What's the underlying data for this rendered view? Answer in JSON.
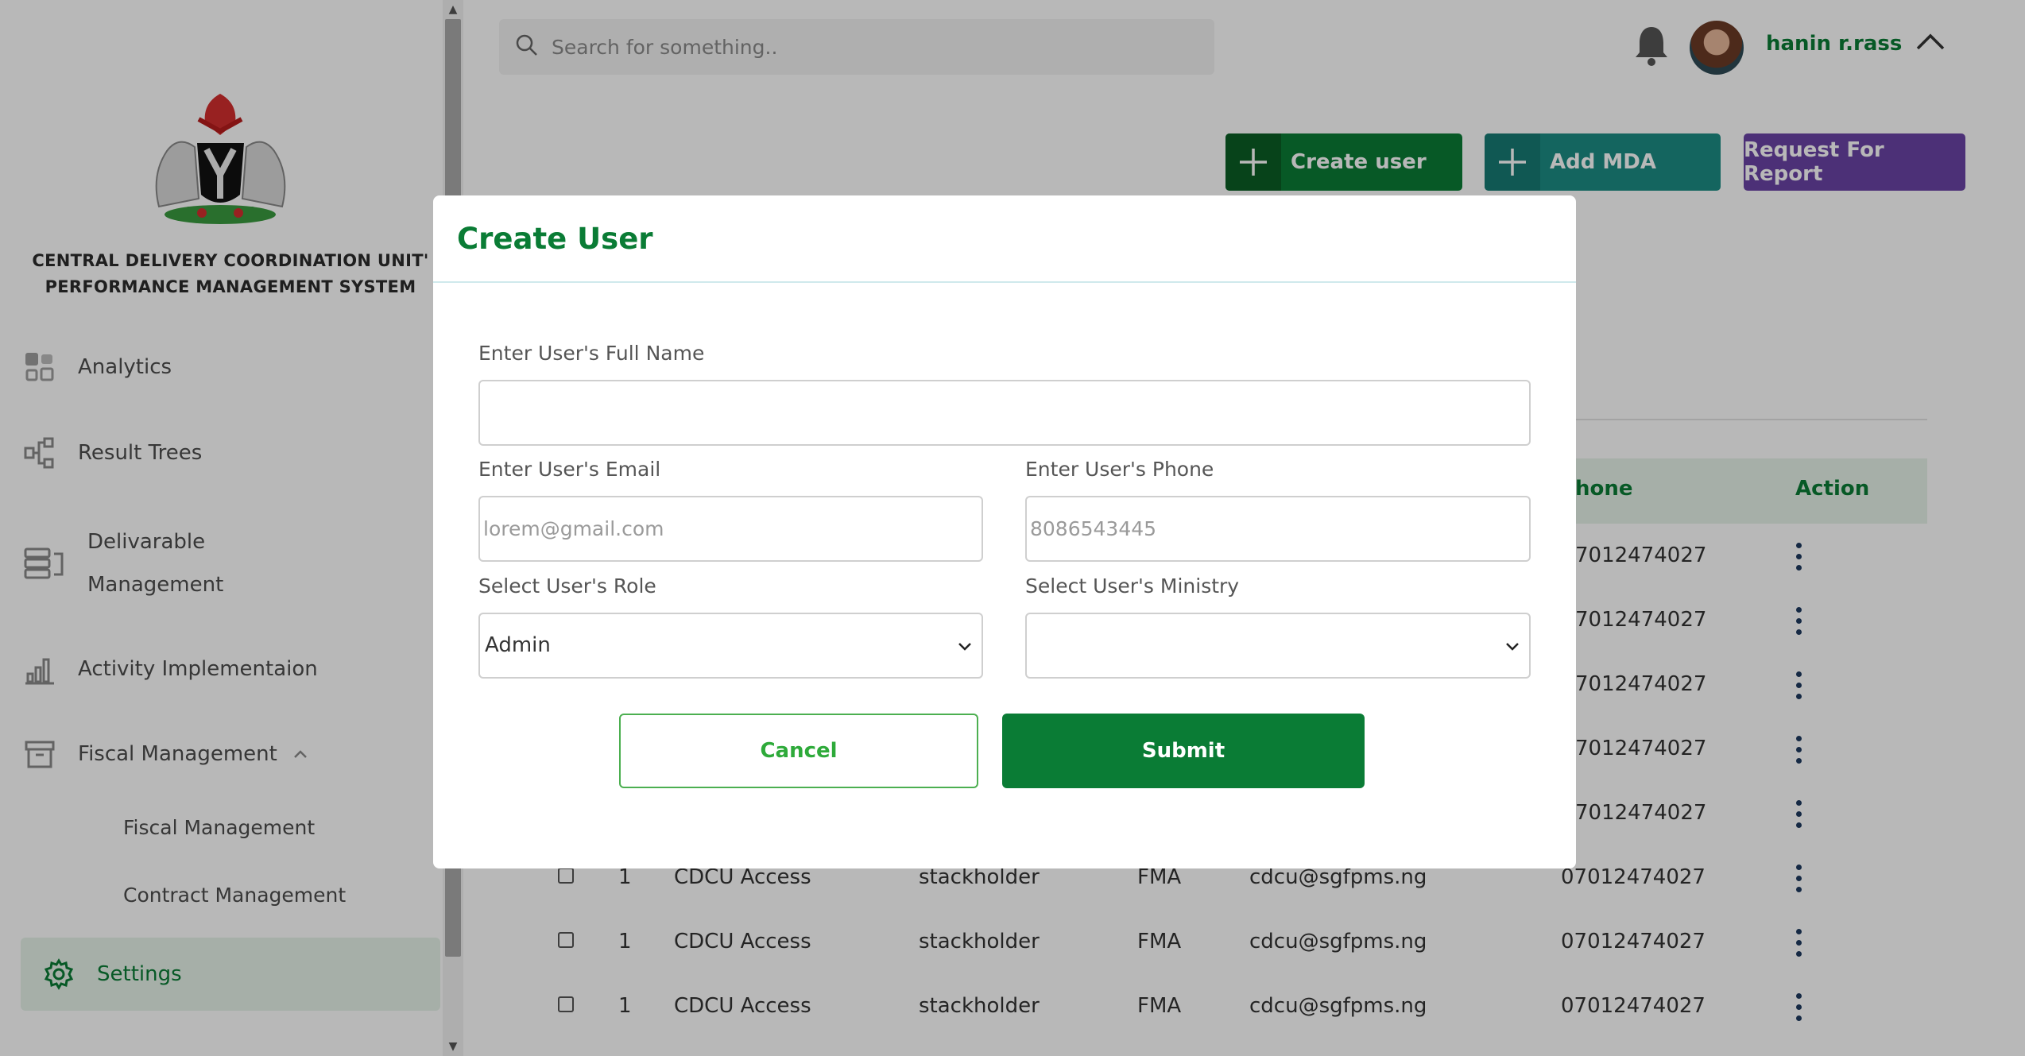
{
  "sidebar": {
    "org_name_line1": "CENTRAL DELIVERY COORDINATION UNIT'",
    "org_name_line2": "PERFORMANCE MANAGEMENT SYSTEM",
    "items": [
      {
        "label": "Analytics",
        "icon": "analytics-grid-icon"
      },
      {
        "label": "Result Trees",
        "icon": "tree-diagram-icon"
      },
      {
        "label_line1": "Delivarable",
        "label_line2": "Management",
        "icon": "stack-icon"
      },
      {
        "label": "Activity Implementaion",
        "icon": "bar-chart-icon"
      },
      {
        "label": "Fiscal Management",
        "icon": "archive-box-icon"
      },
      {
        "label": "Fiscal Management",
        "sub": true
      },
      {
        "label": "Contract Management",
        "sub": true
      },
      {
        "label": "Settings",
        "icon": "gear-icon",
        "active": true
      }
    ]
  },
  "header": {
    "search_placeholder": "Search for something..",
    "username": "hanin r.rass"
  },
  "actions": {
    "create_user": "Create user",
    "add_mda": "Add MDA",
    "request_report": "Request For Report"
  },
  "table": {
    "headers": {
      "phone_partial": "hone",
      "action": "Action"
    },
    "visible_phones": [
      "7012474027",
      "7012474027",
      "7012474027",
      "7012474027",
      "7012474027"
    ],
    "rows": [
      {
        "num": "1",
        "name": "CDCU Access",
        "role": "stackholder",
        "ministry": "FMA",
        "email": "cdcu@sgfpms.ng",
        "phone": "07012474027"
      },
      {
        "num": "1",
        "name": "CDCU Access",
        "role": "stackholder",
        "ministry": "FMA",
        "email": "cdcu@sgfpms.ng",
        "phone": "07012474027"
      },
      {
        "num": "1",
        "name": "CDCU Access",
        "role": "stackholder",
        "ministry": "FMA",
        "email": "cdcu@sgfpms.ng",
        "phone": "07012474027"
      }
    ]
  },
  "modal": {
    "title": "Create User",
    "full_name_label": "Enter User's Full Name",
    "full_name_value": "",
    "email_label": "Enter User's Email",
    "email_placeholder": "lorem@gmail.com",
    "phone_label": "Enter User's Phone",
    "phone_placeholder": "8086543445",
    "role_label": "Select User's Role",
    "role_value": "Admin",
    "ministry_label": "Select User's Ministry",
    "ministry_value": "",
    "cancel": "Cancel",
    "submit": "Submit"
  },
  "colors": {
    "brand_green": "#0a7c35",
    "teal": "#1c8c84",
    "purple": "#6a43a6",
    "light_green": "#e6f3e9"
  }
}
